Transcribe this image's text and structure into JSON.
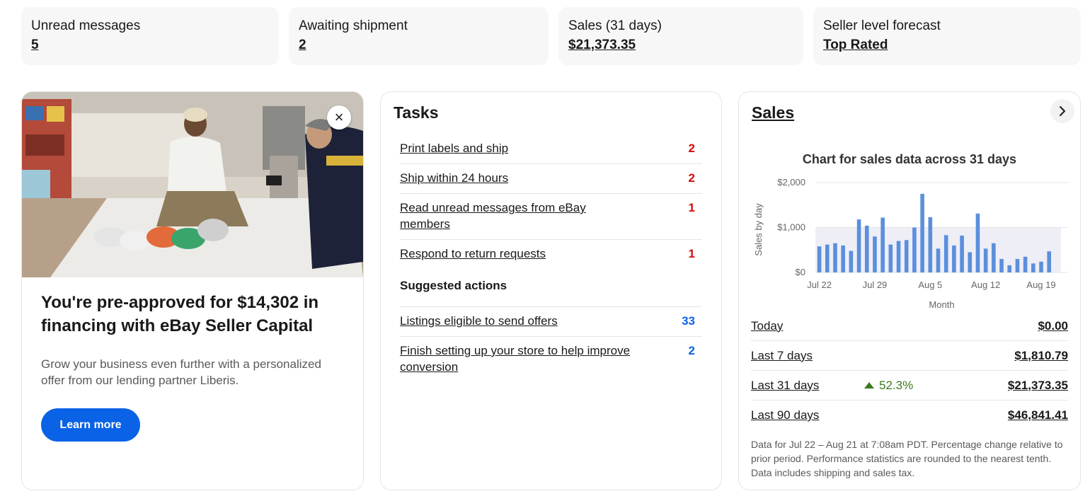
{
  "stats": [
    {
      "label": "Unread messages",
      "value": "5"
    },
    {
      "label": "Awaiting shipment",
      "value": "2"
    },
    {
      "label": "Sales (31 days)",
      "value": "$21,373.35"
    },
    {
      "label": "Seller level forecast",
      "value": "Top Rated"
    }
  ],
  "promo": {
    "title": "You're pre-approved for $14,302 in financing with eBay Seller Capital",
    "description": "Grow your business even further with a personalized offer from our lending partner Liberis.",
    "button_label": "Learn more",
    "close_icon": "×"
  },
  "tasks": {
    "title": "Tasks",
    "items": [
      {
        "label": "Print labels and ship",
        "count": "2",
        "color": "#d50b0b"
      },
      {
        "label": "Ship within 24 hours",
        "count": "2",
        "color": "#d50b0b"
      },
      {
        "label": "Read unread messages from eBay members",
        "count": "1",
        "color": "#d50b0b"
      },
      {
        "label": "Respond to return requests",
        "count": "1",
        "color": "#d50b0b"
      }
    ],
    "suggested_heading": "Suggested actions",
    "suggested": [
      {
        "label": "Listings eligible to send offers",
        "count": "33",
        "color": "#0a62e6"
      },
      {
        "label": "Finish setting up your store to help improve conversion",
        "count": "2",
        "color": "#0a62e6"
      }
    ]
  },
  "sales": {
    "title": "Sales",
    "chevron_icon": "chevron-right-icon",
    "periods": [
      {
        "label": "Today",
        "change": "",
        "value": "$0.00"
      },
      {
        "label": "Last 7 days",
        "change": "",
        "value": "$1,810.79"
      },
      {
        "label": "Last 31 days",
        "change": "52.3%",
        "value": "$21,373.35"
      },
      {
        "label": "Last 90 days",
        "change": "",
        "value": "$46,841.41"
      }
    ],
    "footnote": "Data for Jul 22 – Aug 21 at 7:08am PDT. Percentage change relative to prior period. Performance statistics are rounded to the nearest tenth. Data includes shipping and sales tax."
  },
  "chart_data": {
    "type": "bar",
    "title": "Chart for sales data across 31 days",
    "xlabel": "Month",
    "ylabel": "Sales by day",
    "ylim": [
      0,
      2000
    ],
    "yticks": [
      "$0",
      "$1,000",
      "$2,000"
    ],
    "xticks": [
      "Jul 22",
      "Jul 29",
      "Aug 5",
      "Aug 12",
      "Aug 19"
    ],
    "grid": true,
    "bar_color": "#5b8fdc",
    "categories": [
      "Jul 22",
      "Jul 23",
      "Jul 24",
      "Jul 25",
      "Jul 26",
      "Jul 27",
      "Jul 28",
      "Jul 29",
      "Jul 30",
      "Jul 31",
      "Aug 1",
      "Aug 2",
      "Aug 3",
      "Aug 4",
      "Aug 5",
      "Aug 6",
      "Aug 7",
      "Aug 8",
      "Aug 9",
      "Aug 10",
      "Aug 11",
      "Aug 12",
      "Aug 13",
      "Aug 14",
      "Aug 15",
      "Aug 16",
      "Aug 17",
      "Aug 18",
      "Aug 19",
      "Aug 20",
      "Aug 21"
    ],
    "values": [
      580,
      620,
      650,
      600,
      480,
      1180,
      1040,
      800,
      1220,
      620,
      700,
      720,
      1000,
      1750,
      1230,
      530,
      830,
      600,
      820,
      450,
      1310,
      530,
      650,
      300,
      160,
      300,
      350,
      200,
      240,
      470,
      0
    ]
  }
}
